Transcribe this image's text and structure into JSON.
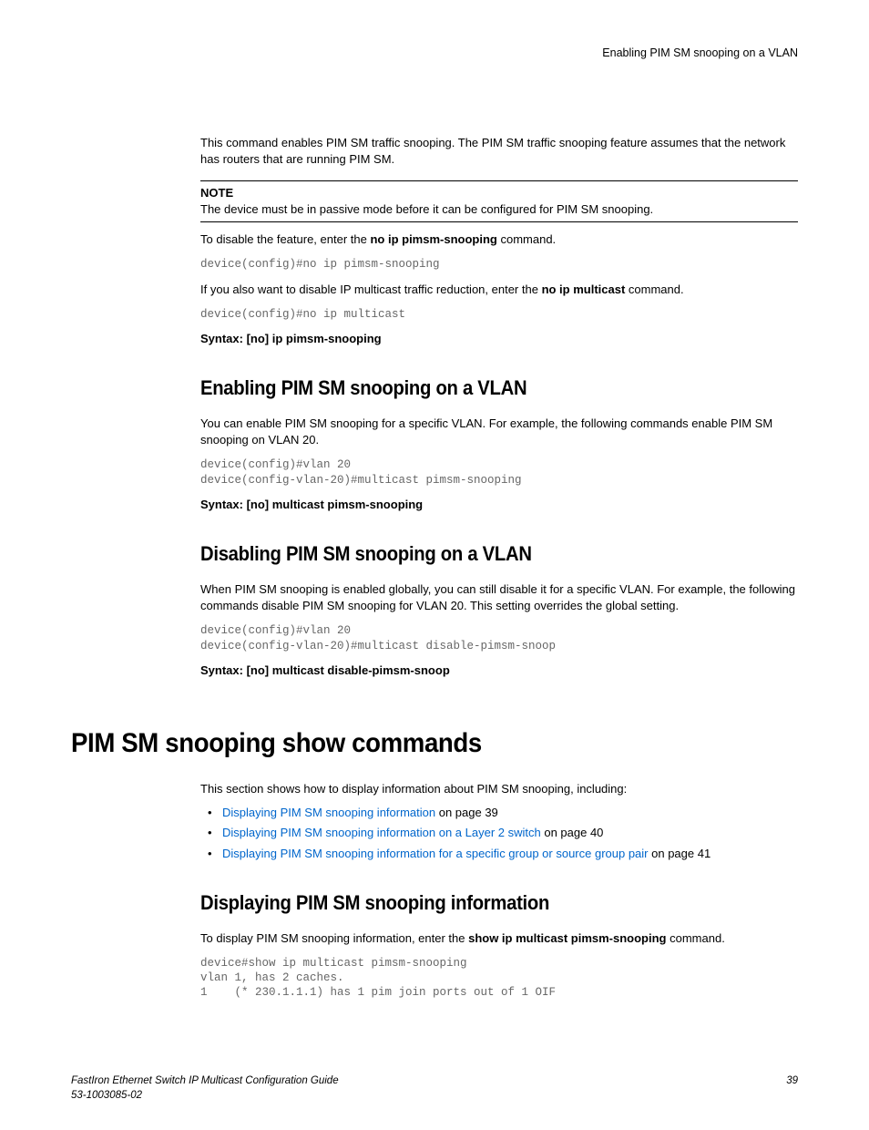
{
  "header": {
    "running_title": "Enabling PIM SM snooping on a VLAN"
  },
  "intro": {
    "p1": "This command enables PIM SM traffic snooping. The PIM SM traffic snooping feature assumes that the network has routers that are running PIM SM.",
    "note_label": "NOTE",
    "note_text": "The device must be in passive mode before it can be configured for PIM SM snooping.",
    "p2a": "To disable the feature, enter the ",
    "p2b": "no ip pimsm-snooping",
    "p2c": " command.",
    "code1": "device(config)#no ip pimsm-snooping",
    "p3a": "If you also want to disable IP multicast traffic reduction, enter the ",
    "p3b": "no ip multicast",
    "p3c": " command.",
    "code2": "device(config)#no ip multicast",
    "syntax1": "Syntax: [no] ip pimsm-snooping"
  },
  "sec1": {
    "title": "Enabling PIM SM snooping on a VLAN",
    "p1": "You can enable PIM SM snooping for a specific VLAN. For example, the following commands enable PIM SM snooping on VLAN 20.",
    "code": "device(config)#vlan 20\ndevice(config-vlan-20)#multicast pimsm-snooping",
    "syntax": "Syntax: [no] multicast pimsm-snooping"
  },
  "sec2": {
    "title": "Disabling PIM SM snooping on a VLAN",
    "p1": "When PIM SM snooping is enabled globally, you can still disable it for a specific VLAN. For example, the following commands disable PIM SM snooping for VLAN 20. This setting overrides the global setting.",
    "code": "device(config)#vlan 20\ndevice(config-vlan-20)#multicast disable-pimsm-snoop",
    "syntax": "Syntax: [no] multicast disable-pimsm-snoop"
  },
  "chapter": {
    "title": "PIM SM snooping show commands",
    "intro": "This section shows how to display information about PIM SM snooping, including:",
    "links": [
      {
        "text": "Displaying PIM SM snooping information",
        "suffix": " on page 39"
      },
      {
        "text": "Displaying PIM SM snooping information on a Layer 2 switch",
        "suffix": " on page 40"
      },
      {
        "text": "Displaying PIM SM snooping information for a specific group or source group pair",
        "suffix": " on page 41"
      }
    ]
  },
  "sec3": {
    "title": "Displaying PIM SM snooping information",
    "p1a": "To display PIM SM snooping information, enter the ",
    "p1b": "show ip multicast pimsm-snooping",
    "p1c": " command.",
    "code": "device#show ip multicast pimsm-snooping  \nvlan 1, has 2 caches.\n1    (* 230.1.1.1) has 1 pim join ports out of 1 OIF"
  },
  "footer": {
    "line1": "FastIron Ethernet Switch IP Multicast Configuration Guide",
    "line2": "53-1003085-02",
    "page": "39"
  }
}
